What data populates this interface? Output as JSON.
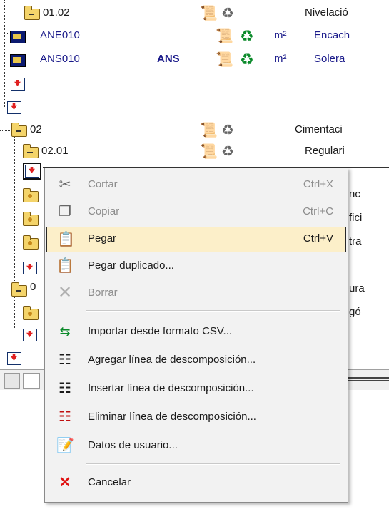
{
  "tree": {
    "rows": [
      {
        "code": "01.02",
        "desc": "Nivelació"
      },
      {
        "code": "ANE010",
        "unit": "m²",
        "desc": "Encach"
      },
      {
        "code": "ANS010",
        "abbr": "ANS",
        "unit": "m²",
        "desc": "Solera"
      },
      {
        "code": "02",
        "desc": "Cimentaci"
      },
      {
        "code": "02.01",
        "desc": "Regulari"
      }
    ],
    "behind_fragments": [
      "nc",
      "fici",
      "tra",
      "ura",
      "gó"
    ],
    "behind_digit": "0"
  },
  "context_menu": {
    "items": [
      {
        "label": "Cortar",
        "shortcut": "Ctrl+X",
        "icon": "scissors-icon",
        "enabled": false
      },
      {
        "label": "Copiar",
        "shortcut": "Ctrl+C",
        "icon": "copy-icon",
        "enabled": false
      },
      {
        "label": "Pegar",
        "shortcut": "Ctrl+V",
        "icon": "paste-icon",
        "enabled": true,
        "highlighted": true
      },
      {
        "label": "Pegar duplicado...",
        "icon": "paste-duplicate-icon",
        "enabled": true
      },
      {
        "label": "Borrar",
        "icon": "delete-x-icon",
        "enabled": false
      },
      {
        "label": "Importar desde formato CSV...",
        "icon": "import-csv-icon",
        "enabled": true
      },
      {
        "label": "Agregar línea de descomposición...",
        "icon": "add-line-icon",
        "enabled": true
      },
      {
        "label": "Insertar línea de descomposición...",
        "icon": "insert-line-icon",
        "enabled": true
      },
      {
        "label": "Eliminar línea de descomposición...",
        "icon": "remove-line-icon",
        "enabled": true
      },
      {
        "label": "Datos de usuario...",
        "icon": "user-data-icon",
        "enabled": true
      },
      {
        "label": "Cancelar",
        "icon": "cancel-icon",
        "enabled": true
      }
    ]
  },
  "colors": {
    "highlight_bg": "#fcefc9",
    "menu_bg": "#f2f2f2",
    "disabled_text": "#8d8d8d",
    "link_blue": "#1a1a8a"
  }
}
